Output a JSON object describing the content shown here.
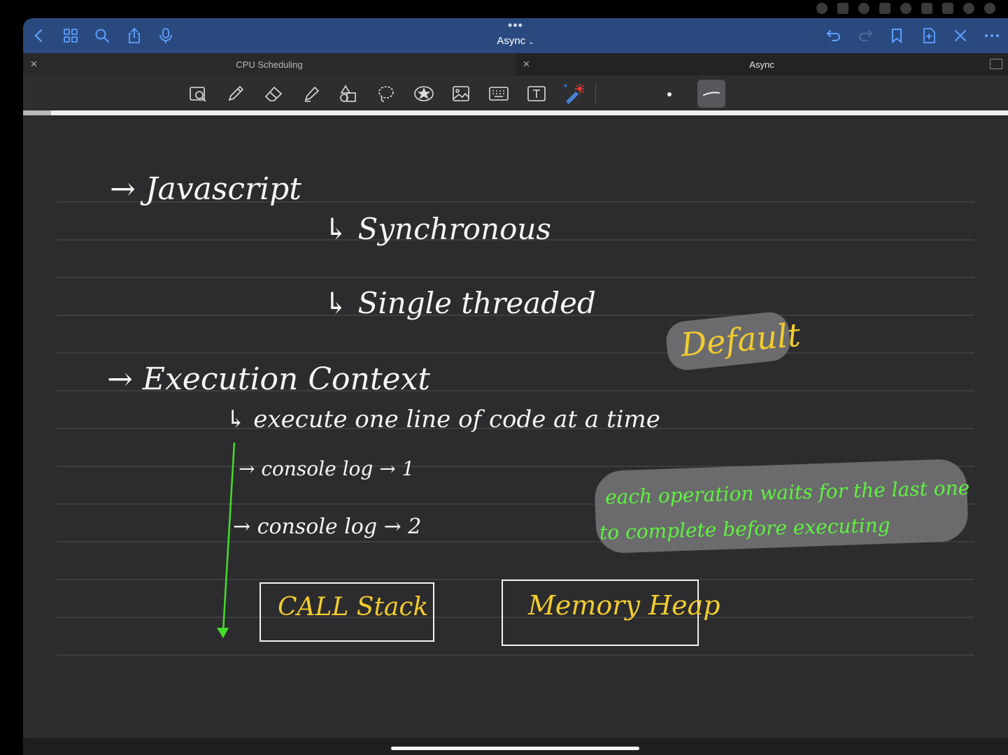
{
  "nav": {
    "title": "Async",
    "dots": "•••",
    "left_icons": [
      "back-chevron-icon",
      "grid-icon",
      "search-icon",
      "share-icon",
      "microphone-icon"
    ],
    "right_icons": [
      "undo-icon",
      "redo-icon",
      "bookmark-icon",
      "add-page-icon",
      "close-icon",
      "more-icon"
    ]
  },
  "tabs": [
    {
      "label": "CPU Scheduling",
      "active": false
    },
    {
      "label": "Async",
      "active": true
    }
  ],
  "toolbar": {
    "tools": [
      "zoom-box-icon",
      "pen-icon",
      "eraser-icon",
      "highlighter-icon",
      "shapes-icon",
      "lasso-icon",
      "sticker-icon",
      "image-icon",
      "keyboard-icon",
      "text-box-icon",
      "laser-pointer-icon"
    ]
  },
  "notes": {
    "line1": "→  Javascript",
    "line2": "↳  Synchronous",
    "line3": "↳  Single  threaded",
    "default_label": "Default",
    "line4": "→  Execution  Context",
    "line5": "↳ execute  one  line  of  code  at  a  time",
    "line6": "→ console log → 1",
    "line7": "→ console log → 2",
    "green_note_1": "each operation waits for the last one",
    "green_note_2": "to complete before executing",
    "call_stack": "CALL Stack",
    "memory_heap": "Memory Heap"
  },
  "colors": {
    "nav_bar": "#2a4a7f",
    "ink_white": "#f5f5f5",
    "ink_yellow": "#f2cc2e",
    "ink_green": "#5ff23f",
    "highlight": "#6f6f72",
    "page": "#2c2c2e"
  }
}
